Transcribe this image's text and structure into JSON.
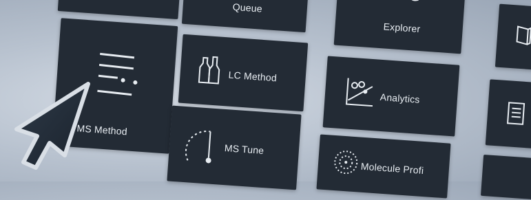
{
  "tiles": {
    "queue": "Queue",
    "explorer": "Explorer",
    "lc_method": "LC Method",
    "ms_method": "MS Method",
    "analytics": "Analytics",
    "ms_tune": "MS Tune",
    "molecule_profiler": "Molecule Profi"
  },
  "colors": {
    "tile_bg": "#232b35",
    "tile_text": "#e8edf2",
    "background": "#b8c2cf"
  },
  "icons": {
    "lc_method": "bottles-icon",
    "ms_method": "list-icon",
    "analytics": "scatter-chart-icon",
    "ms_tune": "dial-icon",
    "molecule_profiler": "dotted-circle-icon",
    "right_top": "book-icon",
    "right_mid": "document-list-icon"
  }
}
